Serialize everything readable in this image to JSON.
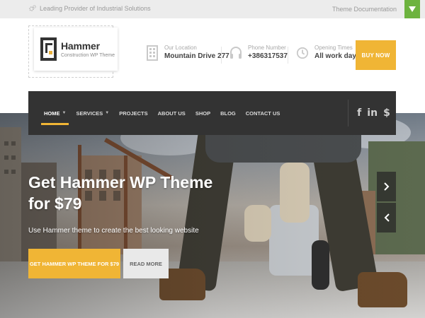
{
  "topbar": {
    "tagline": "Leading Provider of Industrial Solutions",
    "doc_link": "Theme Documentation",
    "tagline_icon": "gear-icon",
    "toggle_icon": "triangle-down-icon",
    "toggle_color": "#6db33f"
  },
  "logo": {
    "title": "Hammer",
    "subtitle": "Construction WP Theme"
  },
  "header": {
    "location": {
      "label": "Our Location",
      "value": "Mountain Drive 277",
      "icon": "building-icon"
    },
    "phone": {
      "label": "Phone Number",
      "value": "+386317537",
      "icon": "headset-icon"
    },
    "hours": {
      "label": "Opening Times",
      "value": "All work days",
      "icon": "clock-icon"
    },
    "buy_label": "BUY NOW"
  },
  "nav": {
    "items": [
      {
        "label": "HOME",
        "has_caret": true,
        "active": true
      },
      {
        "label": "SERVICES",
        "has_caret": true,
        "active": false
      },
      {
        "label": "PROJECTS",
        "has_caret": false,
        "active": false
      },
      {
        "label": "ABOUT US",
        "has_caret": false,
        "active": false
      },
      {
        "label": "SHOP",
        "has_caret": false,
        "active": false
      },
      {
        "label": "BLOG",
        "has_caret": false,
        "active": false
      },
      {
        "label": "CONTACT US",
        "has_caret": false,
        "active": false
      }
    ],
    "social": [
      {
        "icon": "facebook-icon",
        "glyph": "f"
      },
      {
        "icon": "linkedin-icon",
        "glyph": "in"
      },
      {
        "icon": "foursquare-icon",
        "glyph": "$"
      }
    ]
  },
  "hero": {
    "headline": "Get Hammer WP Theme for $79",
    "subline": "Use Hammer theme to create the best looking website",
    "primary_cta": "GET HAMMER WP THEME FOR $79",
    "secondary_cta": "READ MORE"
  },
  "colors": {
    "accent": "#f0b535",
    "nav_bg": "#333333",
    "topbar_bg": "#ececec"
  }
}
